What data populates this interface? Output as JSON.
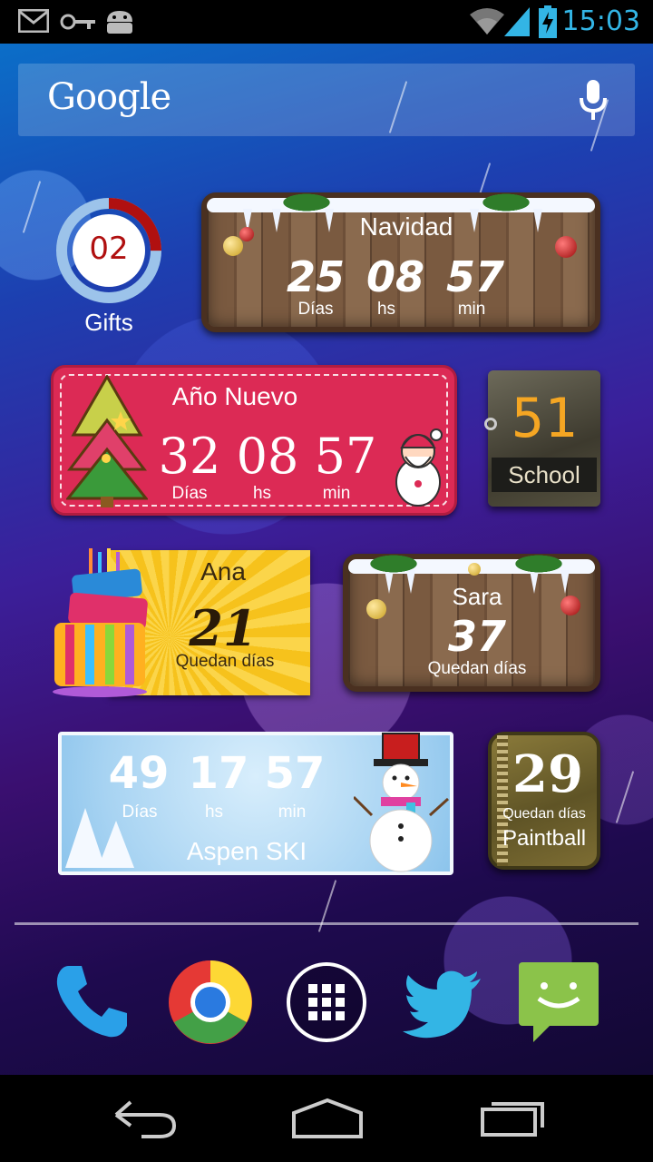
{
  "status_bar": {
    "time": "15:03",
    "icons": [
      "gmail-icon",
      "key-icon",
      "android-icon",
      "wifi-icon",
      "signal-icon",
      "battery-charging-icon"
    ],
    "clock_color": "#33b5e5"
  },
  "search": {
    "logo": "Google",
    "mic_icon": "mic-icon"
  },
  "widgets": {
    "gifts": {
      "count": "02",
      "label": "Gifts",
      "progress_fraction": 0.25,
      "accent": "#b01010"
    },
    "navidad": {
      "title": "Navidad",
      "days": "25",
      "hours": "08",
      "minutes": "57",
      "days_label": "Días",
      "hours_label": "hs",
      "minutes_label": "min"
    },
    "ano_nuevo": {
      "title": "Año Nuevo",
      "days": "32",
      "hours": "08",
      "minutes": "57",
      "days_label": "Días",
      "hours_label": "hs",
      "minutes_label": "min",
      "color": "#dc2a55"
    },
    "school": {
      "count": "51",
      "label": "School",
      "digit_color": "#f5a623"
    },
    "ana": {
      "name": "Ana",
      "count": "21",
      "label": "Quedan días"
    },
    "sara": {
      "name": "Sara",
      "count": "37",
      "label": "Quedan días"
    },
    "aspen": {
      "days": "49",
      "hours": "17",
      "minutes": "57",
      "days_label": "Días",
      "hours_label": "hs",
      "minutes_label": "min",
      "title": "Aspen SKI"
    },
    "paintball": {
      "count": "29",
      "sublabel": "Quedan días",
      "label": "Paintball"
    }
  },
  "dock": [
    "phone-icon",
    "chrome-icon",
    "app-drawer-icon",
    "twitter-icon",
    "messaging-icon"
  ],
  "nav": [
    "back-icon",
    "home-icon",
    "recents-icon"
  ]
}
